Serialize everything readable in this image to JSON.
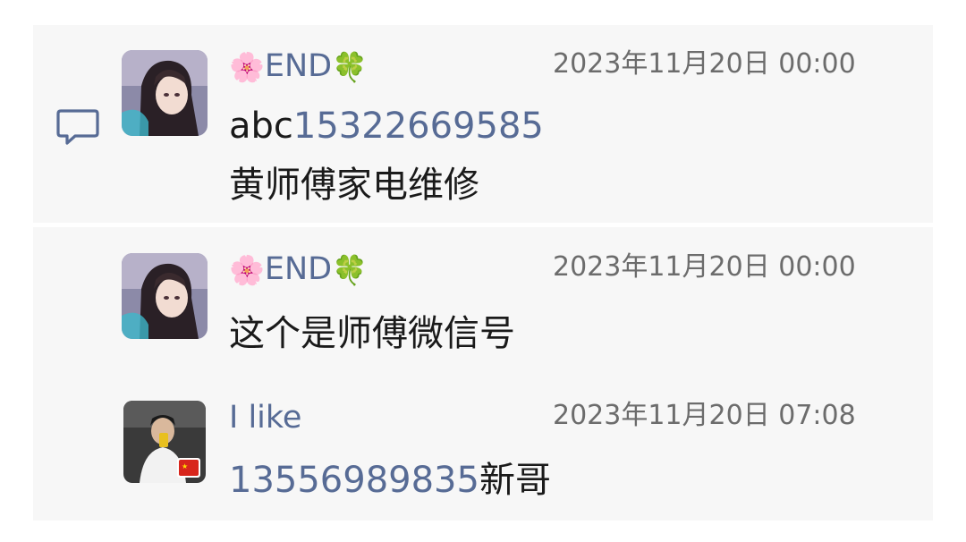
{
  "comments": [
    {
      "user": {
        "flower": "🌸",
        "name": "END",
        "clover": "🍀"
      },
      "time": "2023年11月20日 00:00",
      "prefix": "abc",
      "phone": "15322669585",
      "line2": "黄师傅家电维修"
    },
    {
      "user": {
        "flower": "🌸",
        "name": "END",
        "clover": "🍀"
      },
      "time": "2023年11月20日 00:00",
      "text": "这个是师傅微信号"
    },
    {
      "user": {
        "name": "I like"
      },
      "time": "2023年11月20日 07:08",
      "phone": "13556989835",
      "suffix": "新哥"
    }
  ],
  "icons": {
    "comment": "comment-bubble-icon",
    "flag": "china-flag-icon"
  },
  "colors": {
    "link": "#576b95",
    "panel": "#f7f7f7",
    "time": "#6c6c6c",
    "text": "#1a1a1a"
  }
}
